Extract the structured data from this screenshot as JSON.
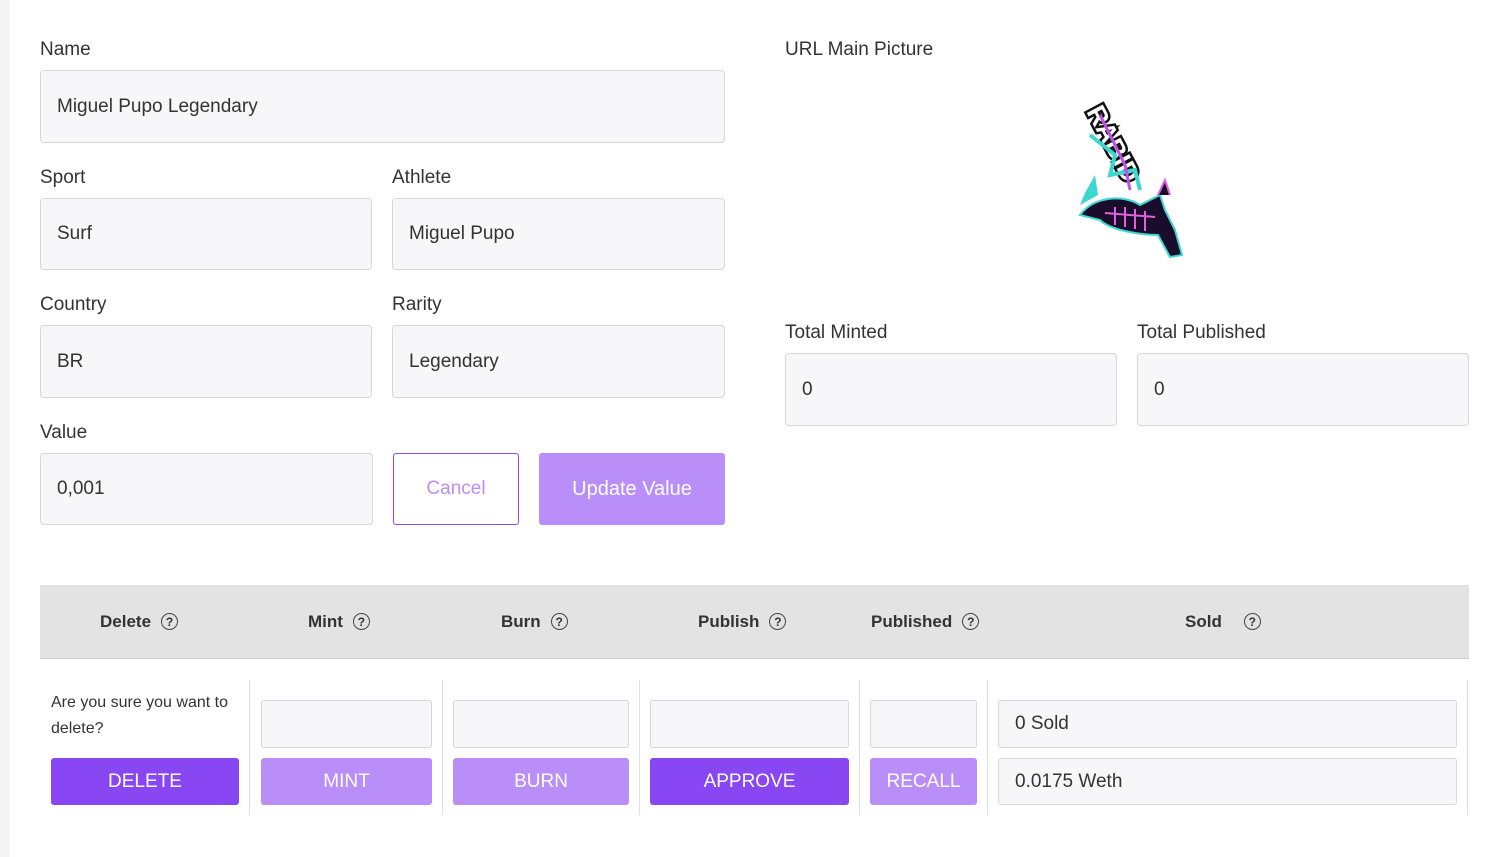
{
  "form": {
    "name_label": "Name",
    "name_value": "Miguel Pupo Legendary",
    "sport_label": "Sport",
    "sport_value": "Surf",
    "athlete_label": "Athlete",
    "athlete_value": "Miguel Pupo",
    "country_label": "Country",
    "country_value": "BR",
    "rarity_label": "Rarity",
    "rarity_value": "Legendary",
    "value_label": "Value",
    "value_value": "0,001",
    "cancel_label": "Cancel",
    "update_label": "Update Value"
  },
  "picture": {
    "label": "URL Main Picture",
    "logo_text": "RABID",
    "icon": "rabbit-logo-icon"
  },
  "stats": {
    "minted_label": "Total Minted",
    "minted_value": "0",
    "published_label": "Total Published",
    "published_value": "0"
  },
  "table": {
    "headers": [
      "Delete",
      "Mint",
      "Burn",
      "Publish",
      "Published",
      "Sold"
    ],
    "help_glyph": "?",
    "delete_confirm": "Are you sure you want to delete?",
    "delete_button": "DELETE",
    "mint_button": "MINT",
    "burn_button": "BURN",
    "approve_button": "APPROVE",
    "recall_button": "RECALL",
    "sold_count": "0 Sold",
    "sold_amount": "0.0175 Weth"
  },
  "colors": {
    "accent_dark": "#8847f2",
    "accent_light": "#b98ef8",
    "field_bg": "#f7f7f9",
    "header_bg": "#e3e3e3"
  }
}
